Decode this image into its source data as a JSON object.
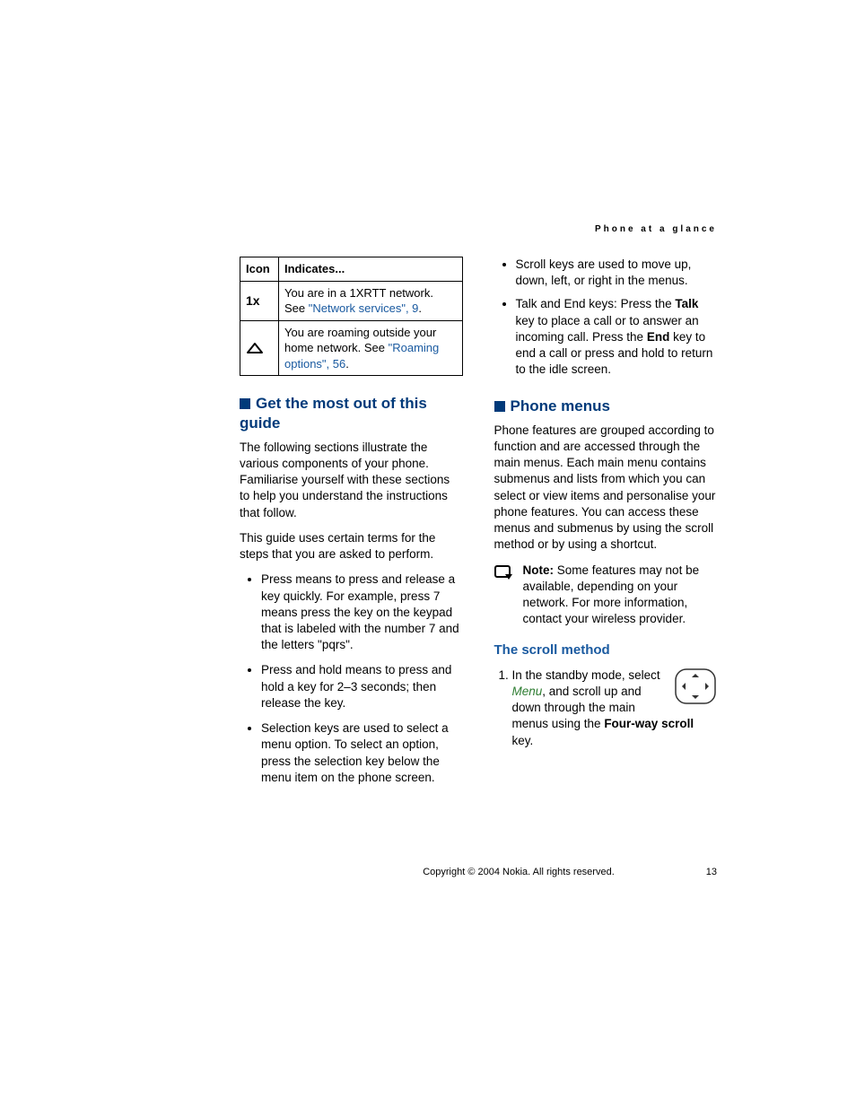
{
  "running_header": "Phone at a glance",
  "table": {
    "headers": [
      "Icon",
      "Indicates..."
    ],
    "rows": [
      {
        "icon_label": "1x-network-icon",
        "text_before": "You are in a 1XRTT network. See ",
        "link": "\"Network services\", 9",
        "text_after": "."
      },
      {
        "icon_label": "roaming-icon",
        "text_before": "You are roaming outside your home network. See ",
        "link": "\"Roaming options\", 56",
        "text_after": "."
      }
    ]
  },
  "section1": {
    "title": "Get the most out of this guide",
    "para1": "The following sections illustrate the various components of your phone. Familiarise yourself with these sections to help you understand the instructions that follow.",
    "para2": "This guide uses certain terms for the steps that you are asked to perform.",
    "bullets": [
      "Press means to press and release a key quickly. For example, press 7 means press the key on the keypad that is labeled with the number 7 and the letters \"pqrs\".",
      "Press and hold means to press and hold a key for 2–3 seconds; then release the key.",
      "Selection keys are used to select a menu option. To select an option, press the selection key below the menu item on the phone screen."
    ]
  },
  "col2_top_bullets": {
    "b1": "Scroll keys are used to move up, down, left, or right in the menus.",
    "b2_pre": "Talk and End keys: Press the ",
    "b2_talk": "Talk",
    "b2_mid": " key to place a call or to answer an incoming call. Press the ",
    "b2_end": "End",
    "b2_post": " key to end a call or press and hold to return to the idle screen."
  },
  "section2": {
    "title": "Phone menus",
    "para1": "Phone features are grouped according to function and are accessed through the main menus. Each main menu contains submenus and lists from which you can select or view items and personalise your phone features. You can access these menus and submenus by using the scroll method or by using a shortcut.",
    "note_label": "Note:",
    "note_text": " Some features may not be available, depending on your network. For more information, contact your wireless provider."
  },
  "subsection": {
    "title": "The scroll method",
    "step1_pre": "In the standby mode, select ",
    "step1_menu": "Menu",
    "step1_mid": ", and scroll up and down through the main menus using the ",
    "step1_key": "Four-way scroll",
    "step1_post": " key."
  },
  "footer": {
    "copyright": "Copyright © 2004 Nokia. All rights reserved.",
    "page": "13"
  }
}
